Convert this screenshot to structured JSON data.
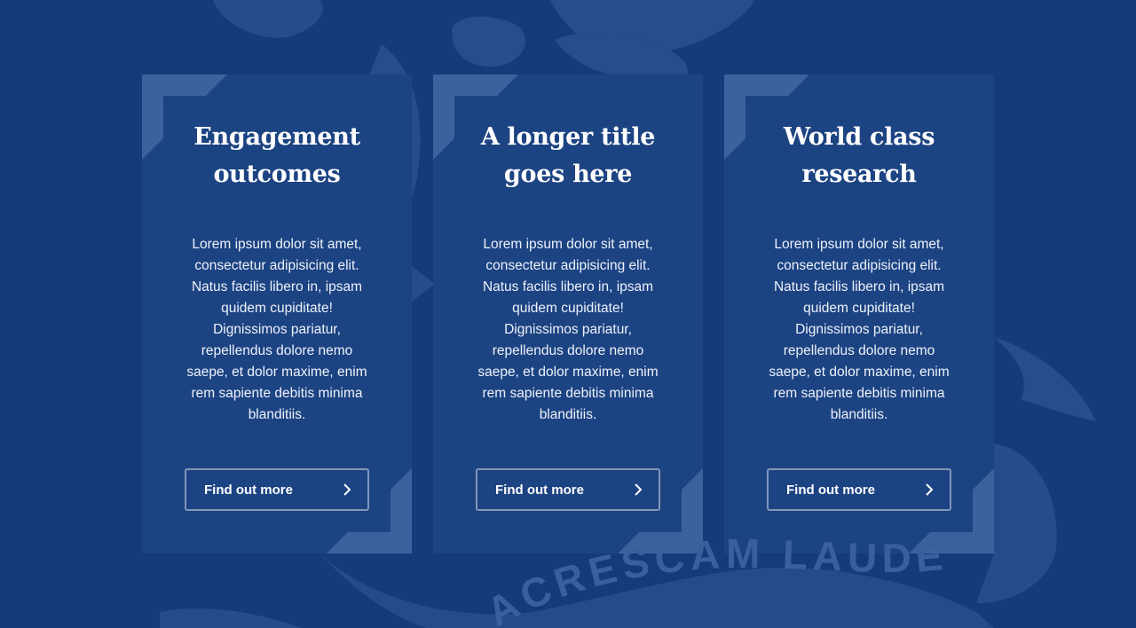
{
  "background": {
    "color": "#163b7a",
    "watermark": "crest-watermark",
    "watermark_motto_visible": "ACRESCAM LAUDE"
  },
  "cards": [
    {
      "title_line1": "Engagement",
      "title_line2": "outcomes",
      "body": "Lorem ipsum dolor sit amet, consectetur adipisicing elit. Natus facilis libero in, ipsam quidem cupiditate! Dignissimos pariatur, repellendus dolore nemo saepe, et dolor maxime, enim rem sapiente debitis minima blanditiis.",
      "button_label": "Find out more",
      "button_icon": "chevron-right-icon"
    },
    {
      "title_line1": "A longer title",
      "title_line2": "goes here",
      "body": "Lorem ipsum dolor sit amet, consectetur adipisicing elit. Natus facilis libero in, ipsam quidem cupiditate! Dignissimos pariatur, repellendus dolore nemo saepe, et dolor maxime, enim rem sapiente debitis minima blanditiis.",
      "button_label": "Find out more",
      "button_icon": "chevron-right-icon"
    },
    {
      "title_line1": "World class",
      "title_line2": "research",
      "body": "Lorem ipsum dolor sit amet, consectetur adipisicing elit. Natus facilis libero in, ipsam quidem cupiditate! Dignissimos pariatur, repellendus dolore nemo saepe, et dolor maxime, enim rem sapiente debitis minima blanditiis.",
      "button_label": "Find out more",
      "button_icon": "chevron-right-icon"
    }
  ],
  "colors": {
    "page_bg": "#163b7a",
    "card_bg": "#1c4382",
    "corner_accent": "#4a6fa8",
    "text": "#ffffff"
  }
}
